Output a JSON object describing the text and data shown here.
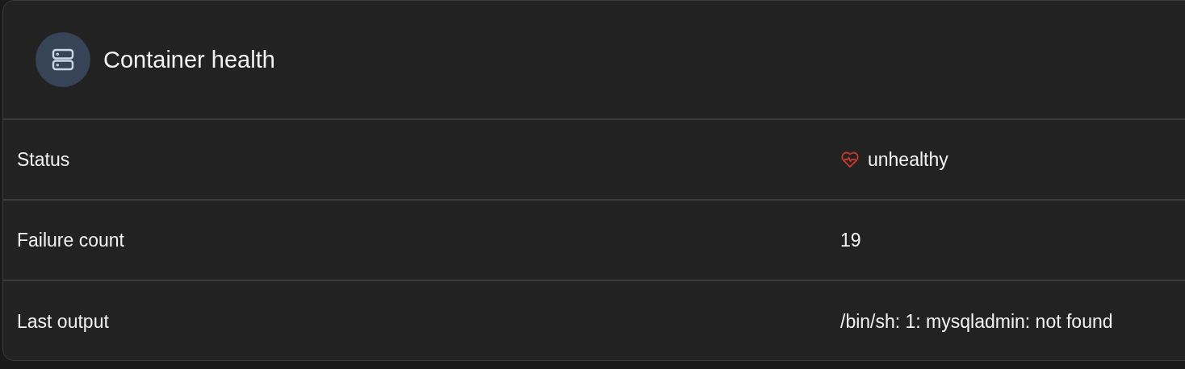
{
  "card": {
    "title": "Container health"
  },
  "rows": [
    {
      "label": "Status",
      "kind": "status",
      "value": "unhealthy"
    },
    {
      "label": "Failure count",
      "kind": "text",
      "value": "19"
    },
    {
      "label": "Last output",
      "kind": "text",
      "value": "/bin/sh: 1: mysqladmin: not found"
    }
  ]
}
